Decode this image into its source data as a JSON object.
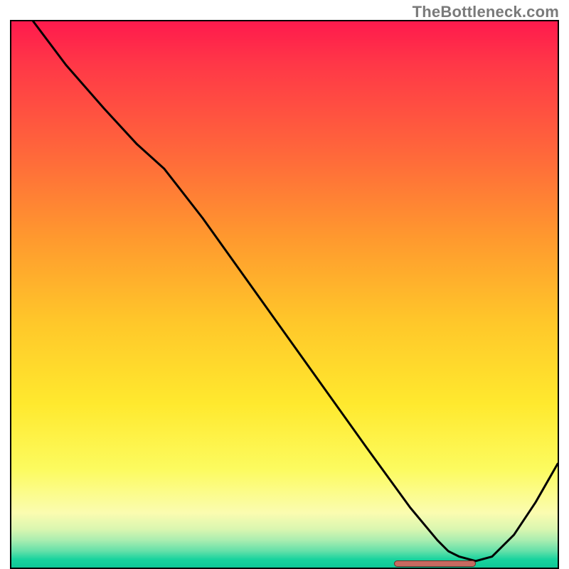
{
  "watermark": "TheBottleneck.com",
  "chart_data": {
    "type": "line",
    "title": "",
    "xlabel": "",
    "ylabel": "",
    "xlim": [
      0,
      100
    ],
    "ylim": [
      0,
      100
    ],
    "series": [
      {
        "name": "curve",
        "x": [
          4,
          10,
          17,
          23,
          28,
          35,
          45,
          55,
          65,
          73,
          78,
          80,
          82,
          85,
          88,
          92,
          96,
          100
        ],
        "y": [
          100,
          92,
          84,
          77.5,
          73,
          64,
          50,
          36,
          22,
          11,
          5,
          3,
          2,
          1.2,
          2,
          6,
          12,
          19
        ]
      }
    ],
    "marker": {
      "x_start": 70,
      "x_end": 85,
      "y": 0.7
    },
    "gradient_stops": [
      {
        "pct": 0,
        "color": "#ff1a4d"
      },
      {
        "pct": 8,
        "color": "#ff3847"
      },
      {
        "pct": 25,
        "color": "#ff6a3a"
      },
      {
        "pct": 40,
        "color": "#ff9a2e"
      },
      {
        "pct": 55,
        "color": "#ffc72a"
      },
      {
        "pct": 70,
        "color": "#ffe92e"
      },
      {
        "pct": 82,
        "color": "#fcfb5f"
      },
      {
        "pct": 90,
        "color": "#fbfcb0"
      },
      {
        "pct": 93,
        "color": "#d9f6b0"
      },
      {
        "pct": 95,
        "color": "#a9edb0"
      },
      {
        "pct": 97,
        "color": "#63e0a9"
      },
      {
        "pct": 98.5,
        "color": "#18d39e"
      },
      {
        "pct": 100,
        "color": "#0fc796"
      }
    ]
  }
}
